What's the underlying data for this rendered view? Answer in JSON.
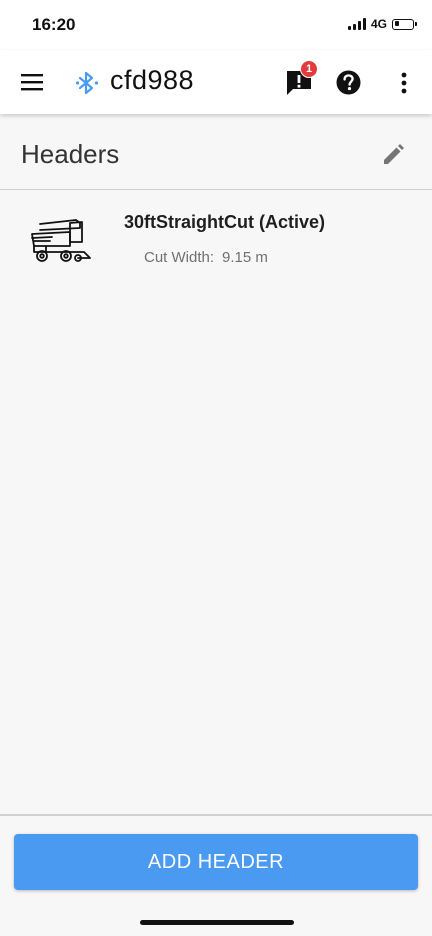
{
  "status_bar": {
    "time": "16:20",
    "network": "4G",
    "battery_level": 0.25
  },
  "app_bar": {
    "title": "cfd988",
    "menu_icon": "hamburger-menu-icon",
    "connection_icon": "bluetooth-icon",
    "alert_icon": "alert-icon",
    "alert_count": "1",
    "help_icon": "help-icon",
    "more_icon": "more-vert-icon",
    "accent_color": "#4a9af2",
    "badge_color": "#e23b3b"
  },
  "section": {
    "title": "Headers",
    "edit_icon": "pencil-icon"
  },
  "headers": [
    {
      "name": "30ftStraightCut (Active)",
      "icon": "combine-harvester-icon",
      "cut_width_label": "Cut Width:",
      "cut_width_value": "9.15 m"
    }
  ],
  "footer": {
    "add_button_label": "ADD HEADER",
    "button_color": "#4a9af2"
  }
}
